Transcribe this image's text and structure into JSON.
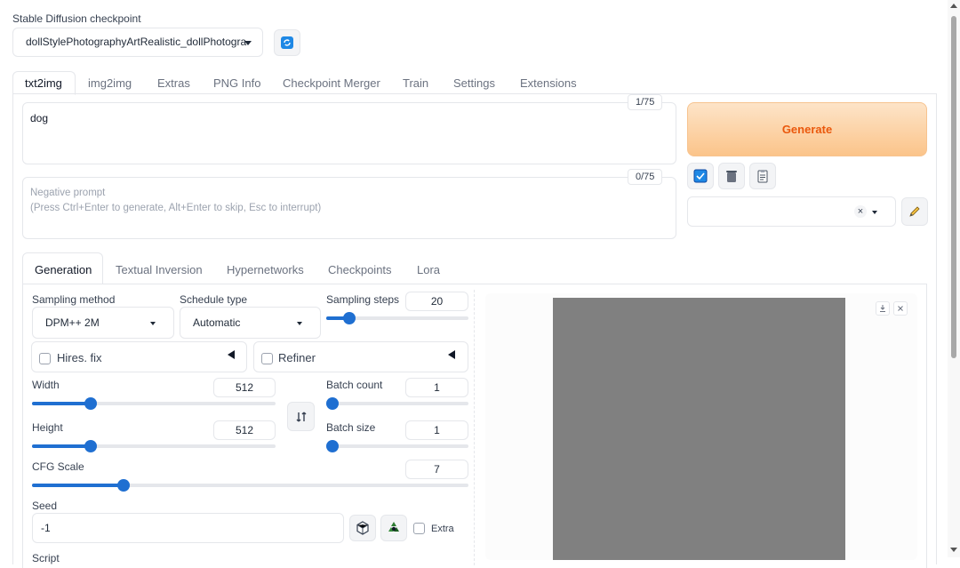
{
  "checkpoint": {
    "label": "Stable Diffusion checkpoint",
    "selected": "dollStylePhotographyArtRealistic_dollPhotogra"
  },
  "main_tabs": [
    "txt2img",
    "img2img",
    "Extras",
    "PNG Info",
    "Checkpoint Merger",
    "Train",
    "Settings",
    "Extensions"
  ],
  "prompt": {
    "value": "dog",
    "counter": "1/75"
  },
  "negative_prompt": {
    "placeholder": "Negative prompt\n(Press Ctrl+Enter to generate, Alt+Enter to skip, Esc to interrupt)",
    "counter": "0/75"
  },
  "generate_label": "Generate",
  "sub_tabs": [
    "Generation",
    "Textual Inversion",
    "Hypernetworks",
    "Checkpoints",
    "Lora"
  ],
  "sampling": {
    "method_label": "Sampling method",
    "method_value": "DPM++ 2M",
    "schedule_label": "Schedule type",
    "schedule_value": "Automatic",
    "steps_label": "Sampling steps",
    "steps_value": "20"
  },
  "hires": {
    "label": "Hires. fix"
  },
  "refiner": {
    "label": "Refiner"
  },
  "width": {
    "label": "Width",
    "value": "512"
  },
  "height": {
    "label": "Height",
    "value": "512"
  },
  "batch_count": {
    "label": "Batch count",
    "value": "1"
  },
  "batch_size": {
    "label": "Batch size",
    "value": "1"
  },
  "cfg": {
    "label": "CFG Scale",
    "value": "7"
  },
  "seed": {
    "label": "Seed",
    "value": "-1",
    "extra_label": "Extra"
  },
  "script": {
    "label": "Script"
  },
  "sliders": {
    "steps": 0.16,
    "width": 0.24,
    "height": 0.24,
    "batch_count": 0.0,
    "batch_size": 0.0,
    "cfg": 0.21
  },
  "colors": {
    "accent": "#1f6fd1",
    "generate_text": "#ea580c",
    "preview": "#808080"
  },
  "icons": {
    "refresh": "refresh-icon",
    "trash": "trash-icon",
    "clipboard": "clipboard-icon",
    "pencil": "pencil-icon",
    "swap": "swap-icon",
    "dice": "dice-icon",
    "recycle": "recycle-icon"
  }
}
